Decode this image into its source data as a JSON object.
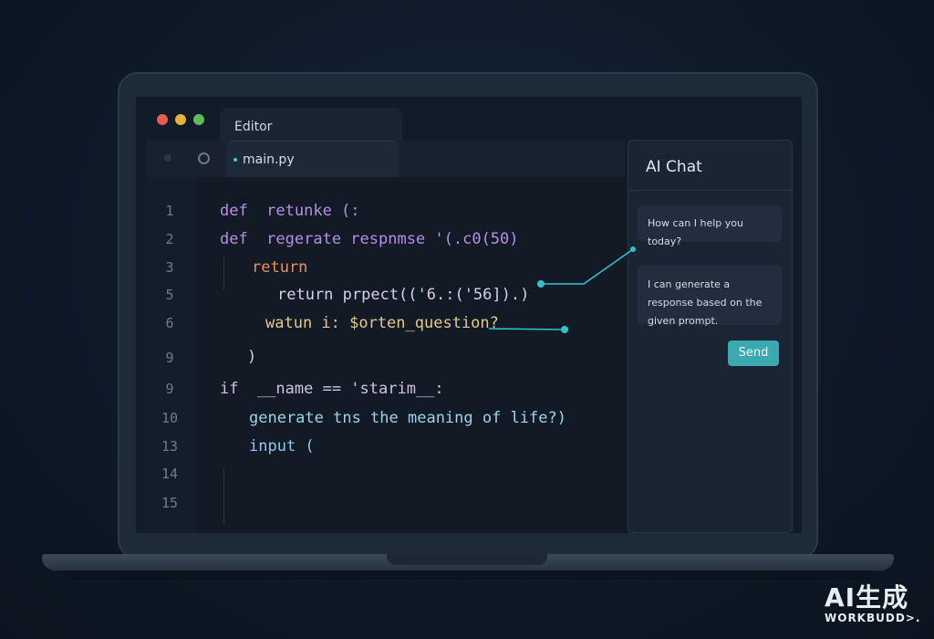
{
  "window": {
    "tab_label": "Editor"
  },
  "editor": {
    "file_tab": "main.py",
    "line_numbers": [
      "1",
      "2",
      "3",
      "5",
      "6",
      "9",
      "9",
      "10",
      "13",
      "14",
      "15"
    ],
    "lines": [
      {
        "text": "def  retunke (:",
        "color": "#b98ee6"
      },
      {
        "text": "def  regerate respnmse '(.c0(50)",
        "color": "#b98ee6"
      },
      {
        "text": "return",
        "color": "#e7925b"
      },
      {
        "text": "return prpect(('6.:('56]).)",
        "color": "#d6cfe8"
      },
      {
        "text": "watun i: $orten_question?",
        "color": "#e7c88b"
      },
      {
        "text": ")",
        "color": "#cbd3dc"
      },
      {
        "text": "if  __name == 'starim__:",
        "color": "#d0c4e0"
      },
      {
        "text": "generate tns the meaning of life?)",
        "color": "#9fd3ea"
      },
      {
        "text": "input (",
        "color": "#8fc7ee"
      }
    ]
  },
  "chat": {
    "title": "AI Chat",
    "messages": [
      {
        "text": "How can I help you today?"
      },
      {
        "text": "I can generate a response based on the given prompt."
      }
    ],
    "send_label": "Send"
  },
  "watermark": {
    "big": "AI生成",
    "small": "WORKBUDD>."
  },
  "colors": {
    "accent": "#3aa9b0",
    "connector": "#35c2d0"
  }
}
